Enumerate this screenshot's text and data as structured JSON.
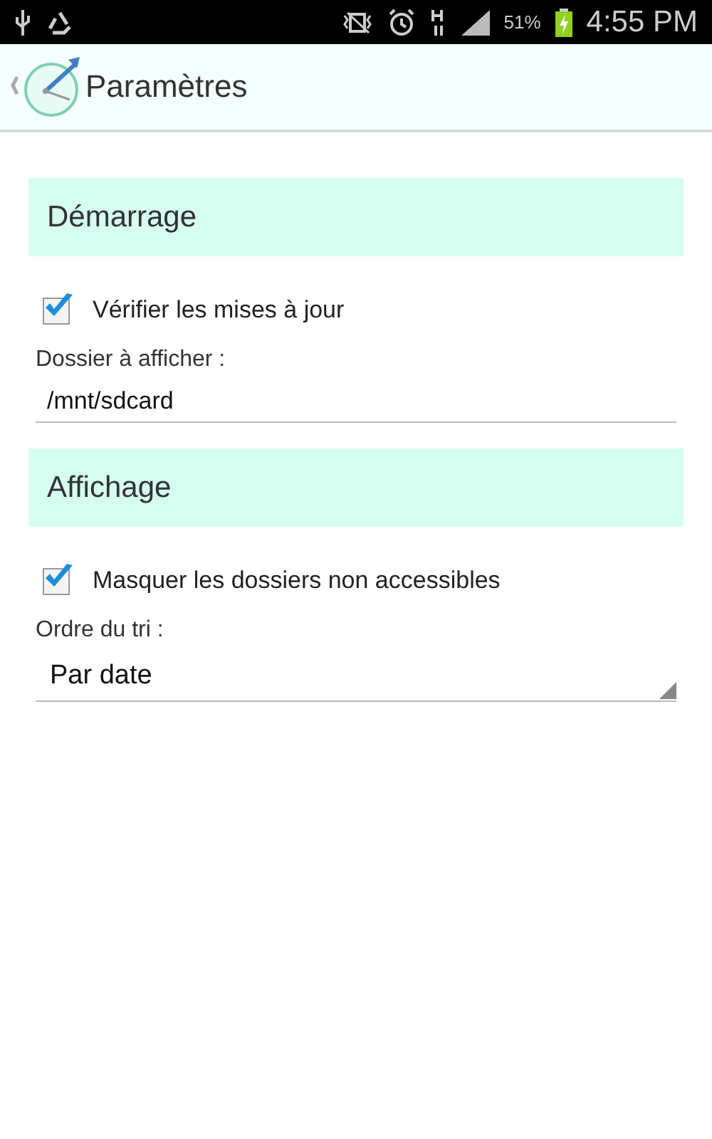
{
  "status_bar": {
    "battery": "51%",
    "time": "4:55 PM"
  },
  "action_bar": {
    "title": "Paramètres"
  },
  "sections": [
    {
      "title": "Démarrage",
      "items": [
        {
          "kind": "checkbox",
          "label": "Vérifier les mises à jour",
          "checked": true
        },
        {
          "kind": "text_field",
          "label": "Dossier à afficher :",
          "value": "/mnt/sdcard"
        }
      ]
    },
    {
      "title": "Affichage",
      "items": [
        {
          "kind": "checkbox",
          "label": "Masquer les dossiers non accessibles",
          "checked": true
        },
        {
          "kind": "dropdown",
          "label": "Ordre du tri :",
          "value": "Par date"
        }
      ]
    }
  ]
}
